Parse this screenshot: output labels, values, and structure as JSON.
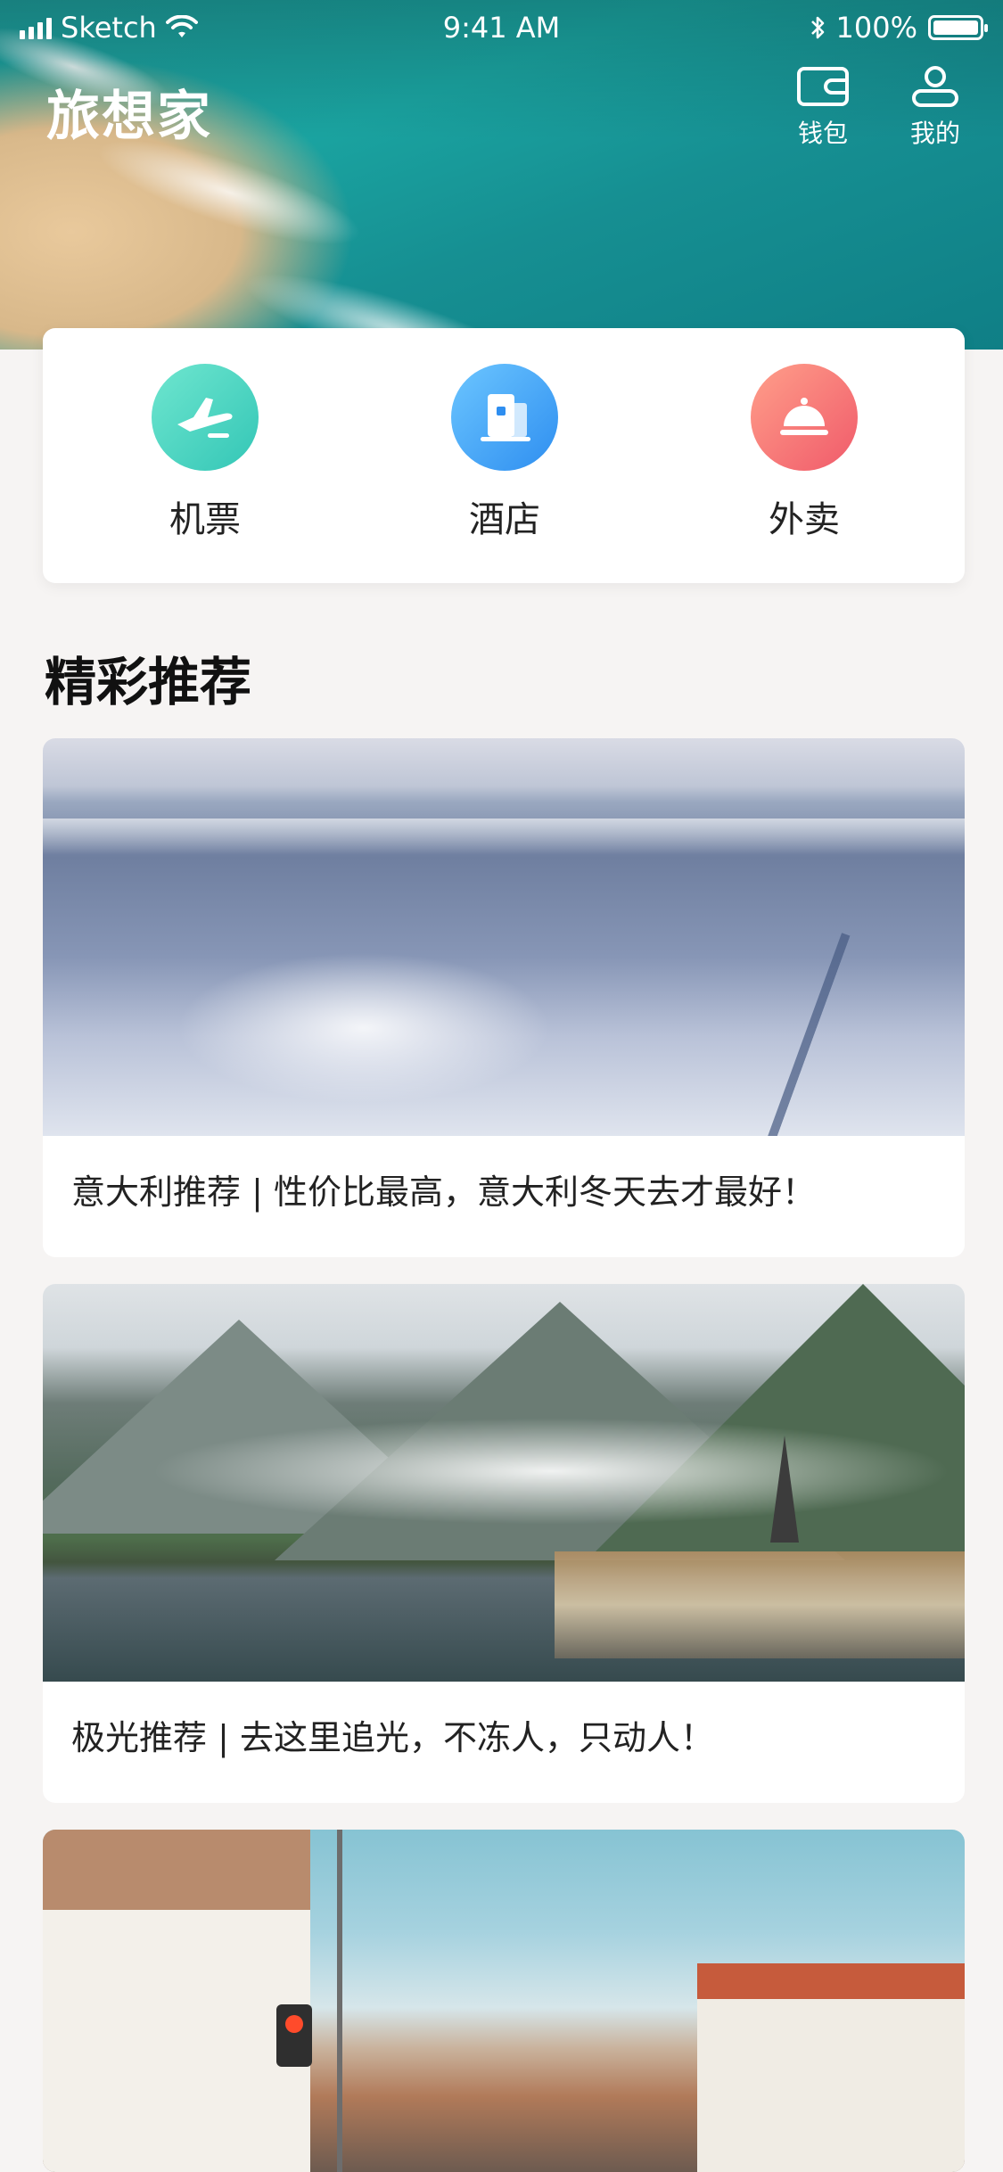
{
  "status_bar": {
    "carrier": "Sketch",
    "time": "9:41 AM",
    "battery": "100%"
  },
  "header": {
    "title": "旅想家",
    "actions": [
      {
        "label": "钱包",
        "icon": "wallet-icon"
      },
      {
        "label": "我的",
        "icon": "user-icon"
      }
    ]
  },
  "quick_menu": [
    {
      "label": "机票",
      "icon": "airplane-icon",
      "color": "#4fd6c0"
    },
    {
      "label": "酒店",
      "icon": "hotel-icon",
      "color": "#3a9cf5"
    },
    {
      "label": "外卖",
      "icon": "service-bell-icon",
      "color": "#f46b6b"
    }
  ],
  "section": {
    "title": "精彩推荐"
  },
  "recommendations": [
    {
      "caption": "意大利推荐 | 性价比最高，意大利冬天去才最好！"
    },
    {
      "caption": "极光推荐 | 去这里追光，不冻人，只动人！"
    },
    {
      "caption": ""
    }
  ]
}
